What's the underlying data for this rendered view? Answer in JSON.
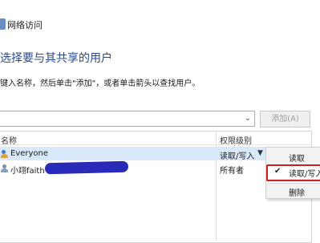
{
  "window": {
    "title": "网络访问"
  },
  "heading": "选择要与其共享的用户",
  "instruction": "键入名称，然后单击\"添加\"，或者单击箭头以查找用户。",
  "name_input": {
    "value": "",
    "placeholder": ""
  },
  "add_button": {
    "label": "添加(A)"
  },
  "table": {
    "columns": [
      "名称",
      "权限级别"
    ],
    "rows": [
      {
        "name": "Everyone",
        "permission": "读取/写入",
        "selected": true,
        "icon": "group-icon"
      },
      {
        "name": "小翊faith",
        "permission": "所有者",
        "selected": false,
        "icon": "user-icon"
      }
    ]
  },
  "context_menu": {
    "items": [
      {
        "label": "读取",
        "checked": false
      },
      {
        "label": "读取/写入",
        "checked": true,
        "highlighted": true
      },
      {
        "label": "删除",
        "checked": false
      }
    ]
  },
  "colors": {
    "accent": "#2b4a8a",
    "selection": "#d9e9fb",
    "highlight_border": "#c82020"
  }
}
